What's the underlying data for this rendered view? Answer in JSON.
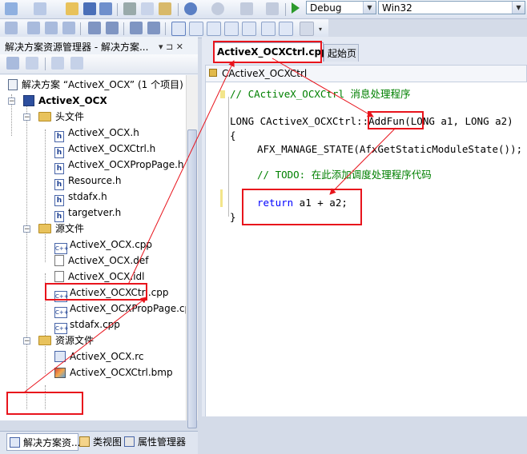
{
  "toolbar": {
    "config": "Debug",
    "platform": "Win32"
  },
  "solution_panel": {
    "title": "解决方案资源管理器 - 解决方案...",
    "pin_glyph": "▾ ⊐ ✕"
  },
  "tree": {
    "solution": "解决方案 “ActiveX_OCX” (1 个项目)",
    "project": "ActiveX_OCX",
    "folder_headers": "头文件",
    "headers": [
      "ActiveX_OCX.h",
      "ActiveX_OCXCtrl.h",
      "ActiveX_OCXPropPage.h",
      "Resource.h",
      "stdafx.h",
      "targetver.h"
    ],
    "folder_sources": "源文件",
    "sources": [
      "ActiveX_OCX.cpp",
      "ActiveX_OCX.def",
      "ActiveX_OCX.idl",
      "ActiveX_OCXCtrl.cpp",
      "ActiveX_OCXPropPage.cpp",
      "stdafx.cpp"
    ],
    "folder_resources": "资源文件",
    "resources": [
      "ActiveX_OCX.rc",
      "ActiveX_OCXCtrl.bmp"
    ]
  },
  "bottom_tabs": [
    "解决方案资...",
    "类视图",
    "属性管理器"
  ],
  "editor": {
    "active_tab": "ActiveX_OCXCtrl.cpp*",
    "start_tab": "起始页",
    "class_scope": "CActiveX_OCXCtrl",
    "lines": {
      "comment1": "// CActiveX_OCXCtrl 消息处理程序",
      "sig_pre": "LONG CActiveX_OCXCtrl::",
      "sig_fn": "AddFun",
      "sig_post": "(LONG a1, LONG a2)",
      "open_brace": "{",
      "manage": "AFX_MANAGE_STATE(AfxGetStaticModuleState());",
      "todo": "// TODO: 在此添加调度处理程序代码",
      "ret_kw": "return",
      "ret_expr": " a1 + a2;",
      "close_brace": "}"
    }
  },
  "colors": {
    "highlight_box": "#e8141c",
    "comment": "#008000",
    "keyword": "#0000ff"
  }
}
